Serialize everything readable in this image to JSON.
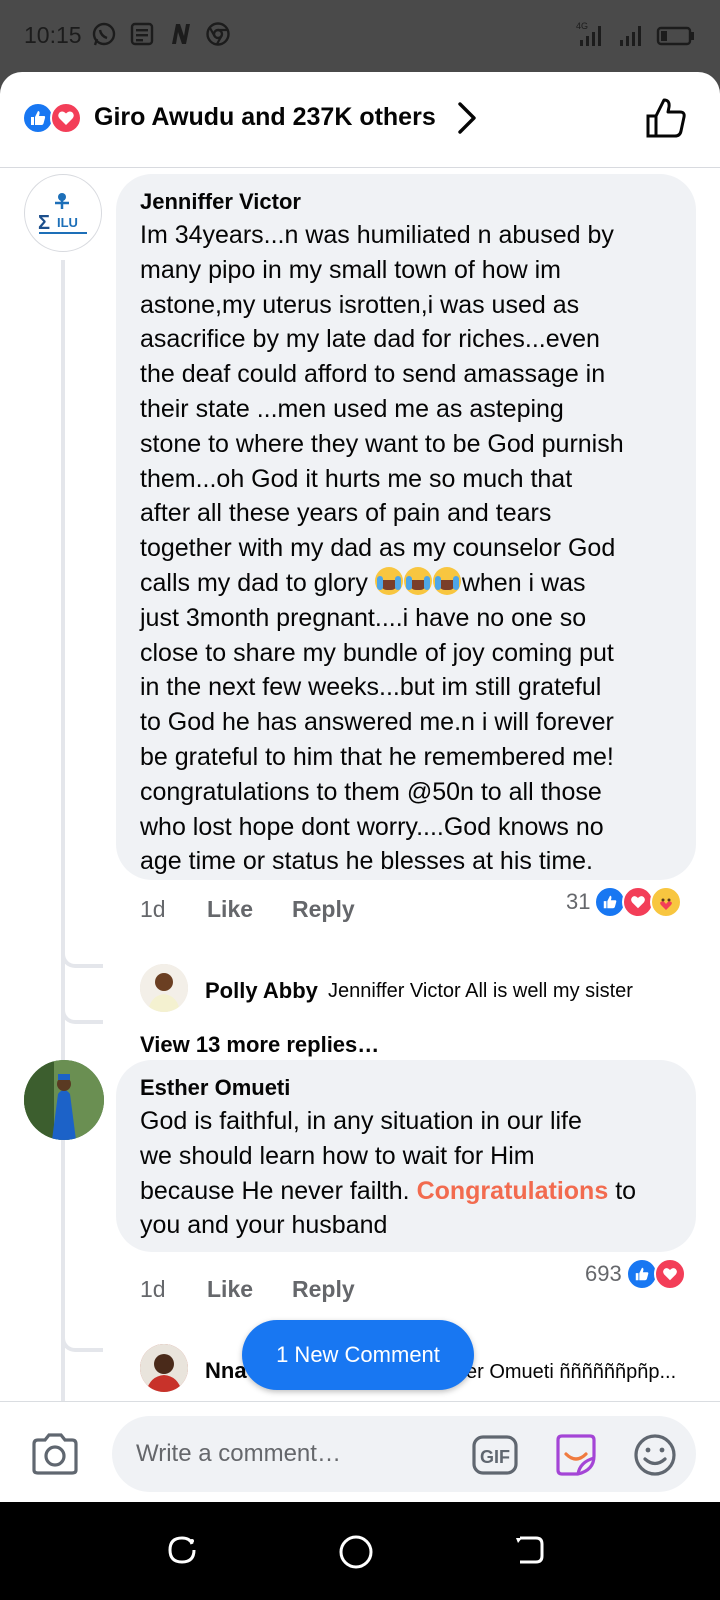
{
  "status_bar": {
    "time": "10:15",
    "left_icons": [
      "whatsapp-icon",
      "news-icon",
      "netflix-icon",
      "chrome-icon"
    ],
    "network": "4G",
    "right_icons": [
      "signal-icon",
      "signal-icon",
      "battery-icon"
    ]
  },
  "reactions_header": {
    "summary": "Giro Awudu and 237K others",
    "reaction_icons": [
      "like-icon",
      "love-icon"
    ]
  },
  "comments": [
    {
      "author": "Jenniffer Victor",
      "text_lines": [
        "Im 34years...n was humiliated n abused by",
        "many pipo in my small town of how im",
        "astone,my uterus isrotten,i was used as",
        "asacrifice by my late dad for riches...even",
        "the deaf could afford to send amassage in",
        "their state ...men used me as asteping",
        "stone to where they want to be God purnish",
        "them...oh God it hurts me so much that",
        "after all these years of pain and tears",
        "together with my dad as my counselor God"
      ],
      "emoji_line_before": "calls my dad to glory",
      "emoji_line_after": "when i was",
      "text_lines_after": [
        "just 3month pregnant....i have no one so",
        "close to share my bundle of joy coming put",
        "in the next few weeks...but im still grateful",
        "to God he has answered me.n i will forever",
        "be grateful to him that he remembered me!",
        "congratulations to them @50n to all those",
        "who lost hope dont worry....God knows no",
        "age time or status he blesses at his time."
      ],
      "time": "1d",
      "like_label": "Like",
      "reply_label": "Reply",
      "reaction_count": "31",
      "reactions": [
        "like-icon",
        "love-icon",
        "care-icon"
      ],
      "reply": {
        "author": "Polly Abby",
        "text": "Jenniffer Victor All is well my sister"
      },
      "view_more": "View 13 more replies…"
    },
    {
      "author": "Esther Omueti",
      "text_lines": [
        "God is faithful, in any situation in our life",
        "we should learn how to wait for Him"
      ],
      "line3_before": "because He never failth.",
      "line3_highlight": "Congratulations",
      "line3_after": "to",
      "line4": "you and your husband",
      "time": "1d",
      "like_label": "Like",
      "reply_label": "Reply",
      "reaction_count": "693",
      "reactions": [
        "like-icon",
        "love-icon"
      ],
      "reply": {
        "author": "Nna",
        "text": "er Omueti ññññññpñp..."
      }
    }
  ],
  "new_comment_pill": "1 New Comment",
  "composer": {
    "placeholder": "Write a comment…",
    "gif_label": "GIF"
  },
  "nav_bar": [
    "recents-icon",
    "home-icon",
    "back-icon"
  ]
}
